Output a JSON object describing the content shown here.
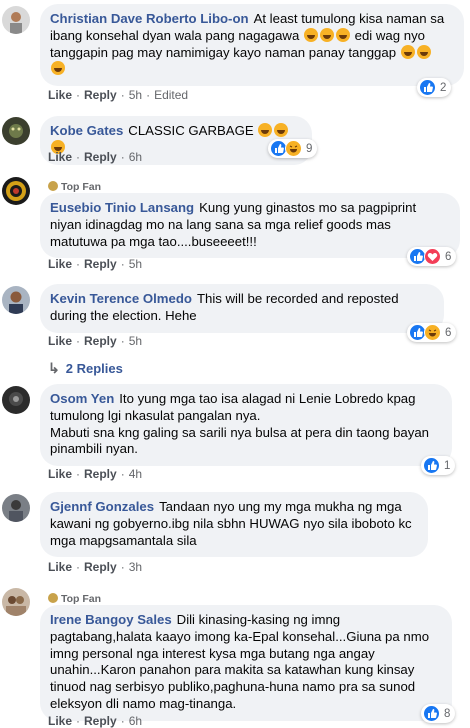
{
  "actions": {
    "like": "Like",
    "reply": "Reply",
    "dot": "·"
  },
  "top_fan_label": "Top Fan",
  "comments": [
    {
      "author": "Christian Dave Roberto Libo-on",
      "text": "At least tumulong kisa naman sa ibang konsehal dyan wala pang nagagawa",
      "text2": "edi wag nyo tanggapin pag may namimigay kayo naman panay tanggap",
      "time": "5h",
      "edited": "Edited",
      "reaction_count": "2"
    },
    {
      "author": "Kobe Gates",
      "text": "CLASSIC GARBAGE",
      "time": "6h",
      "reaction_count": "9"
    },
    {
      "author": "Eusebio Tinio Lansang",
      "text": "Kung yung ginastos mo sa pagpiprint niyan idinagdag mo na lang sana sa mga relief goods mas matutuwa pa mga tao....buseeeet!!!",
      "time": "5h",
      "reaction_count": "6",
      "top_fan": true
    },
    {
      "author": "Kevin Terence Olmedo",
      "text": "This will be recorded and reposted during the election. Hehe",
      "time": "5h",
      "reaction_count": "6"
    },
    {
      "author": "Osom Yen",
      "text": "Ito yung mga tao isa alagad ni Lenie Lobredo kpag tumulong lgi nkasulat pangalan nya.",
      "text2": "Mabuti sna kng galing sa sarili nya bulsa at pera din taong bayan pinambili nyan.",
      "time": "4h",
      "reaction_count": "1"
    },
    {
      "author": "Gjennf Gonzales",
      "text": "Tandaan nyo ung my mga mukha ng mga kawani ng gobyerno.ibg nila sbhn HUWAG nyo sila iboboto kc mga mapgsamantala sila",
      "time": "3h"
    },
    {
      "author": "Irene Bangoy Sales",
      "text": "Dili kinasing-kasing ng imng pagtabang,halata kaayo imong ka-Epal konsehal...Giuna pa nmo imng personal nga interest kysa mga butang nga angay unahin...Karon panahon para makita sa katawhan kung kinsay tinuod nag serbisyo publiko,paghuna-huna namo pra sa sunod eleksyon dli namo mag-tinanga.",
      "time": "6h",
      "reaction_count": "8",
      "top_fan": true
    }
  ],
  "replies_label": "2 Replies",
  "colors": {
    "bubble": "#f0f2f5",
    "author": "#385898",
    "meta": "#65676b",
    "like": "#1877f2",
    "love": "#f33e58",
    "haha": "#f7b125"
  }
}
